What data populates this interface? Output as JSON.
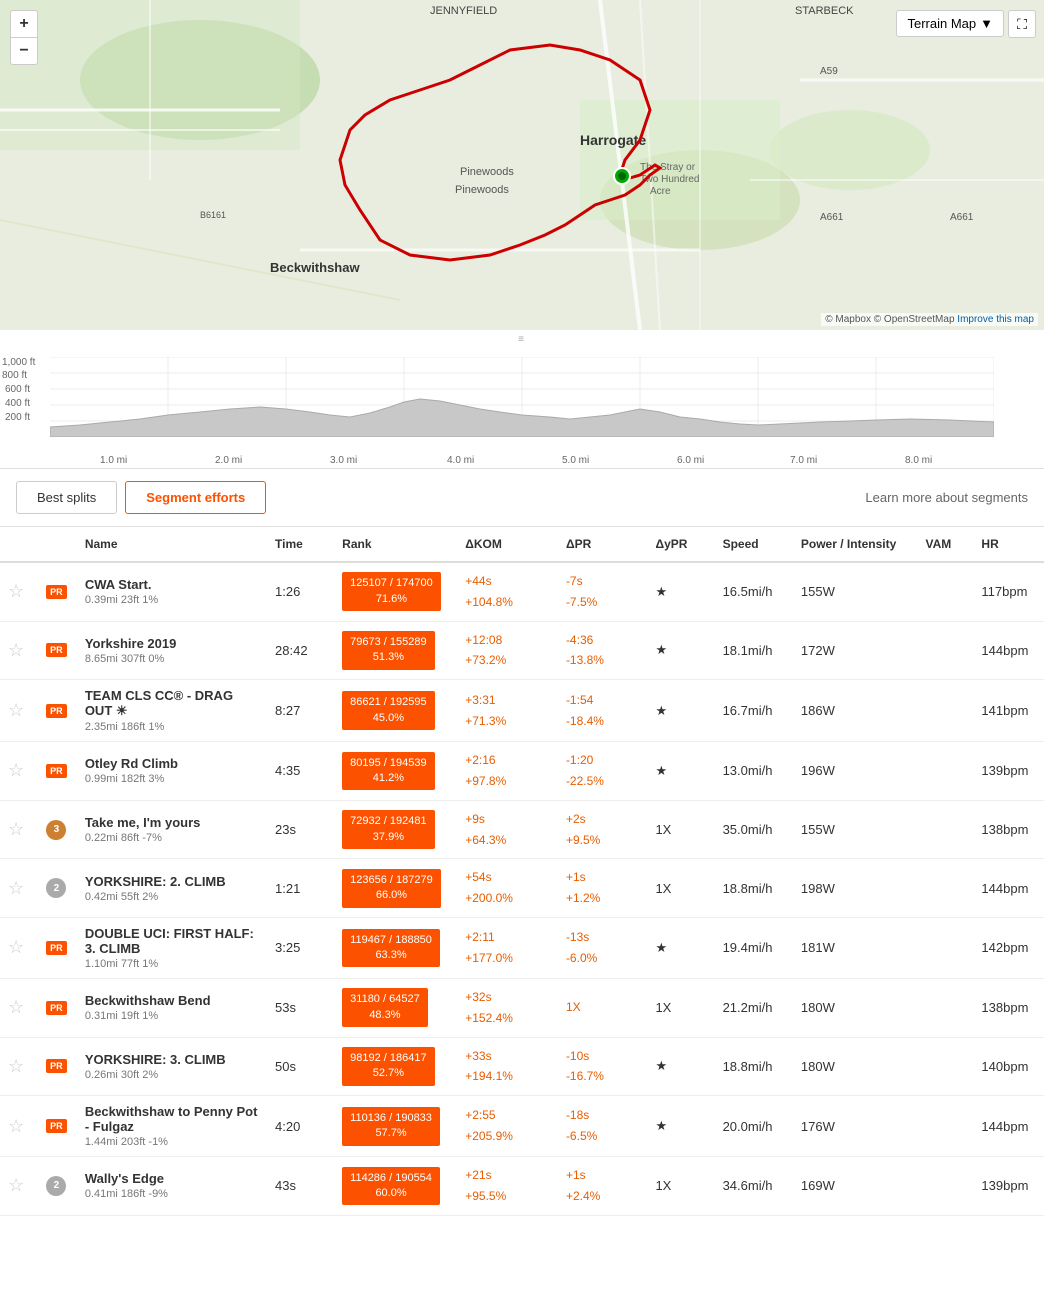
{
  "map": {
    "zoom_in": "+",
    "zoom_out": "−",
    "zoom_level": "59",
    "map_type": "Terrain Map",
    "attribution": "© Mapbox © OpenStreetMap",
    "improve_link": "Improve this map",
    "fullscreen_icon": "⛶"
  },
  "elevation": {
    "drag_handle": "≡",
    "y_labels": [
      "1,000 ft",
      "800 ft",
      "600 ft",
      "400 ft",
      "200 ft"
    ],
    "x_labels": [
      "1.0 mi",
      "2.0 mi",
      "3.0 mi",
      "4.0 mi",
      "5.0 mi",
      "6.0 mi",
      "7.0 mi",
      "8.0 mi"
    ]
  },
  "tabs": {
    "best_splits": "Best splits",
    "segment_efforts": "Segment efforts",
    "learn_more": "Learn more about segments"
  },
  "table": {
    "headers": {
      "name": "Name",
      "time": "Time",
      "rank": "Rank",
      "dkom": "ΔKOM",
      "dpr": "ΔPR",
      "dypr": "ΔyPR",
      "speed": "Speed",
      "power": "Power / Intensity",
      "vam": "VAM",
      "hr": "HR"
    },
    "rows": [
      {
        "starred": false,
        "badge_type": "pr",
        "badge_label": "PR",
        "badge_medal": null,
        "name": "CWA Start.",
        "details": "0.39mi  23ft  1%",
        "time": "1:26",
        "rank_top": "125107 / 174700",
        "rank_pct": "71.6%",
        "dkom": "+44s",
        "dkom2": "+104.8%",
        "dpr": "-7s",
        "dpr2": "-7.5%",
        "dypr": "★",
        "speed": "16.5mi/h",
        "power": "155W",
        "vam": "",
        "hr": "117bpm"
      },
      {
        "starred": false,
        "badge_type": "pr",
        "badge_label": "PR",
        "badge_medal": null,
        "name": "Yorkshire 2019",
        "details": "8.65mi  307ft  0%",
        "time": "28:42",
        "rank_top": "79673 / 155289",
        "rank_pct": "51.3%",
        "dkom": "+12:08",
        "dkom2": "+73.2%",
        "dpr": "-4:36",
        "dpr2": "-13.8%",
        "dypr": "★",
        "speed": "18.1mi/h",
        "power": "172W",
        "vam": "",
        "hr": "144bpm"
      },
      {
        "starred": false,
        "badge_type": "pr",
        "badge_label": "PR",
        "badge_medal": null,
        "name": "TEAM CLS CC® - DRAG OUT ☀",
        "details": "2.35mi  186ft  1%",
        "time": "8:27",
        "rank_top": "86621 / 192595",
        "rank_pct": "45.0%",
        "dkom": "+3:31",
        "dkom2": "+71.3%",
        "dpr": "-1:54",
        "dpr2": "-18.4%",
        "dypr": "★",
        "speed": "16.7mi/h",
        "power": "186W",
        "vam": "",
        "hr": "141bpm"
      },
      {
        "starred": false,
        "badge_type": "pr",
        "badge_label": "PR",
        "badge_medal": null,
        "name": "Otley Rd Climb",
        "details": "0.99mi  182ft  3%",
        "time": "4:35",
        "rank_top": "80195 / 194539",
        "rank_pct": "41.2%",
        "dkom": "+2:16",
        "dkom2": "+97.8%",
        "dpr": "-1:20",
        "dpr2": "-22.5%",
        "dypr": "★",
        "speed": "13.0mi/h",
        "power": "196W",
        "vam": "",
        "hr": "139bpm"
      },
      {
        "starred": false,
        "badge_type": "bronze",
        "badge_label": "3",
        "badge_medal": "3",
        "name": "Take me, I'm yours",
        "details": "0.22mi  86ft  -7%",
        "time": "23s",
        "rank_top": "72932 / 192481",
        "rank_pct": "37.9%",
        "dkom": "+9s",
        "dkom2": "+64.3%",
        "dpr": "+2s",
        "dpr2": "+9.5%",
        "dypr": "1X",
        "speed": "35.0mi/h",
        "power": "155W",
        "vam": "",
        "hr": "138bpm"
      },
      {
        "starred": false,
        "badge_type": "silver",
        "badge_label": "2",
        "badge_medal": "2",
        "name": "YORKSHIRE: 2. CLIMB",
        "details": "0.42mi  55ft  2%",
        "time": "1:21",
        "rank_top": "123656 / 187279",
        "rank_pct": "66.0%",
        "dkom": "+54s",
        "dkom2": "+200.0%",
        "dpr": "+1s",
        "dpr2": "+1.2%",
        "dypr": "1X",
        "speed": "18.8mi/h",
        "power": "198W",
        "vam": "",
        "hr": "144bpm"
      },
      {
        "starred": false,
        "badge_type": "pr",
        "badge_label": "PR",
        "badge_medal": null,
        "name": "DOUBLE UCI: FIRST HALF: 3. CLIMB",
        "details": "1.10mi  77ft  1%",
        "time": "3:25",
        "rank_top": "119467 / 188850",
        "rank_pct": "63.3%",
        "dkom": "+2:11",
        "dkom2": "+177.0%",
        "dpr": "-13s",
        "dpr2": "-6.0%",
        "dypr": "★",
        "speed": "19.4mi/h",
        "power": "181W",
        "vam": "",
        "hr": "142bpm"
      },
      {
        "starred": false,
        "badge_type": "pr",
        "badge_label": "PR",
        "badge_medal": null,
        "name": "Beckwithshaw Bend",
        "details": "0.31mi  19ft  1%",
        "time": "53s",
        "rank_top": "31180 / 64527",
        "rank_pct": "48.3%",
        "dkom": "+32s",
        "dkom2": "+152.4%",
        "dpr": "1X",
        "dpr2": "",
        "dypr": "1X",
        "speed": "21.2mi/h",
        "power": "180W",
        "vam": "",
        "hr": "138bpm"
      },
      {
        "starred": false,
        "badge_type": "pr",
        "badge_label": "PR",
        "badge_medal": null,
        "name": "YORKSHIRE: 3. CLIMB",
        "details": "0.26mi  30ft  2%",
        "time": "50s",
        "rank_top": "98192 / 186417",
        "rank_pct": "52.7%",
        "dkom": "+33s",
        "dkom2": "+194.1%",
        "dpr": "-10s",
        "dpr2": "-16.7%",
        "dypr": "★",
        "speed": "18.8mi/h",
        "power": "180W",
        "vam": "",
        "hr": "140bpm"
      },
      {
        "starred": false,
        "badge_type": "pr",
        "badge_label": "PR",
        "badge_medal": null,
        "name": "Beckwithshaw to Penny Pot - Fulgaz",
        "details": "1.44mi  203ft  -1%",
        "time": "4:20",
        "rank_top": "110136 / 190833",
        "rank_pct": "57.7%",
        "dkom": "+2:55",
        "dkom2": "+205.9%",
        "dpr": "-18s",
        "dpr2": "-6.5%",
        "dypr": "★",
        "speed": "20.0mi/h",
        "power": "176W",
        "vam": "",
        "hr": "144bpm"
      },
      {
        "starred": false,
        "badge_type": "silver",
        "badge_label": "2",
        "badge_medal": "2",
        "name": "Wally's Edge",
        "details": "0.41mi  186ft  -9%",
        "time": "43s",
        "rank_top": "114286 / 190554",
        "rank_pct": "60.0%",
        "dkom": "+21s",
        "dkom2": "+95.5%",
        "dpr": "+1s",
        "dpr2": "+2.4%",
        "dypr": "1X",
        "speed": "34.6mi/h",
        "power": "169W",
        "vam": "",
        "hr": "139bpm"
      }
    ]
  }
}
